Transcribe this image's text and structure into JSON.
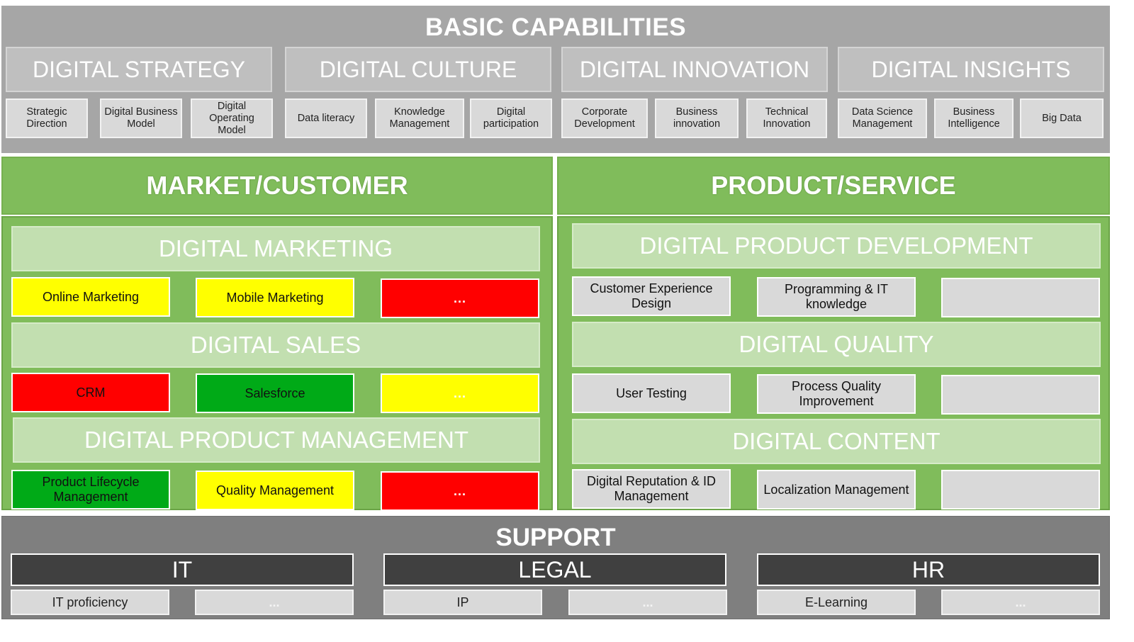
{
  "basic": {
    "title": "BASIC CAPABILITIES",
    "categories": [
      {
        "label": "DIGITAL STRATEGY",
        "items": [
          "Strategic Direction",
          "Digital Business Model",
          "Digital Operating Model"
        ]
      },
      {
        "label": "DIGITAL CULTURE",
        "items": [
          "Data literacy",
          "Knowledge Management",
          "Digital participation"
        ]
      },
      {
        "label": "DIGITAL INNOVATION",
        "items": [
          "Corporate Development",
          "Business innovation",
          "Technical Innovation"
        ]
      },
      {
        "label": "DIGITAL INSIGHTS",
        "items": [
          "Data Science Management",
          "Business Intelligence",
          "Big Data"
        ]
      }
    ]
  },
  "market": {
    "title": "MARKET/CUSTOMER",
    "sections": [
      {
        "label": "DIGITAL MARKETING",
        "items": [
          {
            "label": "Online Marketing",
            "status": "yellow"
          },
          {
            "label": "Mobile Marketing",
            "status": "yellow"
          },
          {
            "label": "...",
            "status": "red"
          }
        ]
      },
      {
        "label": "DIGITAL SALES",
        "items": [
          {
            "label": "CRM",
            "status": "red"
          },
          {
            "label": "Salesforce",
            "status": "green"
          },
          {
            "label": "...",
            "status": "yellow"
          }
        ]
      },
      {
        "label": "DIGITAL PRODUCT MANAGEMENT",
        "items": [
          {
            "label": "Product Lifecycle Management",
            "status": "green"
          },
          {
            "label": "Quality Management",
            "status": "yellow"
          },
          {
            "label": "...",
            "status": "red"
          }
        ]
      }
    ]
  },
  "product": {
    "title": "PRODUCT/SERVICE",
    "sections": [
      {
        "label": "DIGITAL PRODUCT DEVELOPMENT",
        "items": [
          "Customer Experience Design",
          "Programming & IT knowledge",
          ""
        ]
      },
      {
        "label": "DIGITAL QUALITY",
        "items": [
          "User Testing",
          "Process Quality Improvement",
          ""
        ]
      },
      {
        "label": "DIGITAL CONTENT",
        "items": [
          "Digital Reputation & ID Management",
          "Localization Management",
          ""
        ]
      }
    ]
  },
  "support": {
    "title": "SUPPORT",
    "categories": [
      {
        "label": "IT",
        "items": [
          "IT proficiency",
          "..."
        ]
      },
      {
        "label": "LEGAL",
        "items": [
          "IP",
          "..."
        ]
      },
      {
        "label": "HR",
        "items": [
          "E-Learning",
          "..."
        ]
      }
    ]
  },
  "colors": {
    "yellow": "#ffff00",
    "red": "#ff0000",
    "green": "#00aa17",
    "section_green": "#80bc5b",
    "basic_grey": "#a6a6a6",
    "support_grey": "#7f7f7f"
  }
}
